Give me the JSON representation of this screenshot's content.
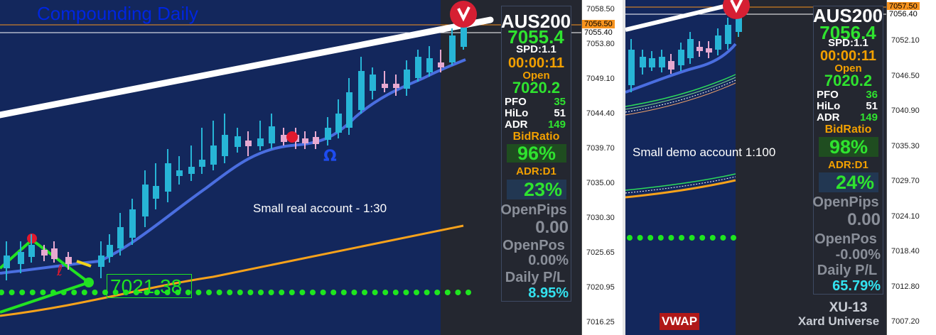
{
  "left_chart": {
    "title": "Compounding Daily",
    "account_note": "Small real account - 1:30",
    "price_box": "7021.38",
    "axis_ticks": [
      "7058.50",
      "7053.80",
      "7049.10",
      "7044.40",
      "7039.70",
      "7035.00",
      "7030.30",
      "7025.65",
      "7020.95",
      "7016.25"
    ],
    "price_tags": [
      {
        "label": "7056.50",
        "bg": "#f7931e",
        "fg": "#000000"
      },
      {
        "label": "7055.40",
        "bg": "#ffffff",
        "fg": "#000000"
      }
    ],
    "panel": {
      "symbol": "AUS200",
      "price": "7055.4",
      "spread": "SPD:1.1",
      "timer": "00:00:11",
      "open_label": "Open",
      "open_value": "7020.2",
      "stats": [
        {
          "label": "PFO",
          "value": "35"
        },
        {
          "label": "HiLo",
          "value": "51"
        },
        {
          "label": "ADR",
          "value": "149"
        }
      ],
      "bidratio_label": "BidRatio",
      "bidratio_value": "96%",
      "adr_d1_label": "ADR:D1",
      "adr_d1_value": "23%",
      "openpips_label": "OpenPips",
      "openpips_value": "0.00",
      "openpos_label": "OpenPos",
      "openpos_value": "0.00%",
      "dailypl_label": "Daily P/L",
      "dailypl_value": "8.95%"
    }
  },
  "right_chart": {
    "account_note": "Small demo account 1:100",
    "axis_ticks": [
      "7052.10",
      "7046.50",
      "7040.90",
      "7035.30",
      "7029.70",
      "7024.10",
      "7018.40",
      "7012.80",
      "7007.20"
    ],
    "price_tags": [
      {
        "label": "7057.50",
        "bg": "#f7931e",
        "fg": "#000000"
      },
      {
        "label": "7056.40",
        "bg": "#ffffff",
        "fg": "#000000"
      }
    ],
    "vwap_label": "VWAP",
    "panel": {
      "symbol": "AUS200",
      "price": "7056.4",
      "spread": "SPD:1.1",
      "timer": "00:00:11",
      "open_label": "Open",
      "open_value": "7020.2",
      "stats": [
        {
          "label": "PFO",
          "value": "36"
        },
        {
          "label": "HiLo",
          "value": "51"
        },
        {
          "label": "ADR",
          "value": "149"
        }
      ],
      "bidratio_label": "BidRatio",
      "bidratio_value": "98%",
      "adr_d1_label": "ADR:D1",
      "adr_d1_value": "24%",
      "openpips_label": "OpenPips",
      "openpips_value": "0.00",
      "openpos_label": "OpenPos",
      "openpos_value": "-0.00%",
      "dailypl_label": "Daily P/L",
      "dailypl_value": "65.79%",
      "footer_title": "XU-13",
      "footer_sub": "Xard Universe"
    }
  },
  "colors": {
    "chart_bg": "#13275c",
    "session_bg": "#242730",
    "bull_candle": "#27b5d6",
    "bear_candle": "#e7a9d0",
    "ma_blue": "#4a6ee0",
    "ma_orange": "#f7a21b",
    "dots_green": "#1fe61f",
    "price_green": "#2fe32f",
    "timer_orange": "#f2a000",
    "grey_text": "#8a8f99",
    "cyan_text": "#33e3f0"
  }
}
